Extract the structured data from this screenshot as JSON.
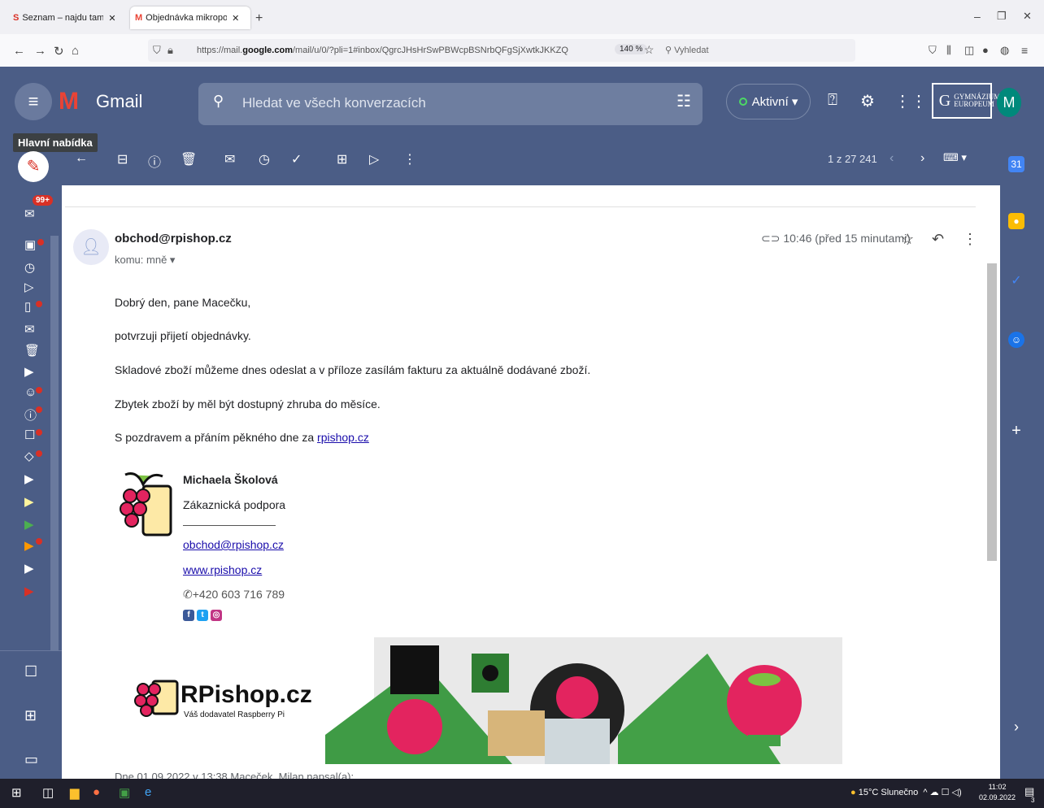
{
  "browser": {
    "tabs": [
      {
        "label": "Seznam – najdu tam, co neznám",
        "icon": "S",
        "active": false
      },
      {
        "label": "Objednávka mikropočítačů a ko",
        "icon": "M",
        "active": true
      }
    ],
    "new_tab": "+",
    "url_prefix": "https://mail.",
    "url_domain": "google.com",
    "url_suffix": "/mail/u/0/?pli=1#inbox/QgrcJHsHrSwPBWcpBSNrbQFgSjXwtkJKKZQ",
    "zoom": "140 %",
    "search_placeholder": "Vyhledat"
  },
  "gmail": {
    "app_name": "Gmail",
    "search_placeholder": "Hledat ve všech konverzacích",
    "status": "Aktivní",
    "org_logo_text": "GYMNÁZIUM EUROPEUM",
    "avatar_letter": "M",
    "tooltip": "Hlavní nabídka",
    "pagination": "1 z 27 241",
    "unread_badge": "99+"
  },
  "email": {
    "sender": "obchod@rpishop.cz",
    "recipient": "komu: mně",
    "time": "10:46 (před 15 minutami)",
    "greeting": "Dobrý den, pane Macečku,",
    "line1": "potvrzuji přijetí objednávky.",
    "line2": "Skladové zboží můžeme dnes odeslat a v příloze zasílám fakturu za aktuálně dodávané zboží.",
    "line3": "Zbytek zboží by měl být dostupný zhruba do měsíce.",
    "closing_text": "S pozdravem a přáním pěkného dne za ",
    "closing_link": "rpishop.cz",
    "signature": {
      "name": "Michaela Školová",
      "role": "Zákaznická podpora",
      "email": "obchod@rpishop.cz",
      "web": "www.rpishop.cz",
      "phone": "+420 603 716 789"
    },
    "banner_brand": "RPishop.cz",
    "banner_sub": "Váš dodavatel Raspberry Pi",
    "quote": "Dne 01.09.2022 v 13:38 Maceček, Milan napsal(a):"
  },
  "taskbar": {
    "weather": "15°C  Slunečno",
    "time": "11:02",
    "date": "02.09.2022",
    "notif_count": "3"
  },
  "colors": {
    "header": "#4b5d86",
    "accent_red": "#d93025",
    "link": "#1a0dab"
  }
}
